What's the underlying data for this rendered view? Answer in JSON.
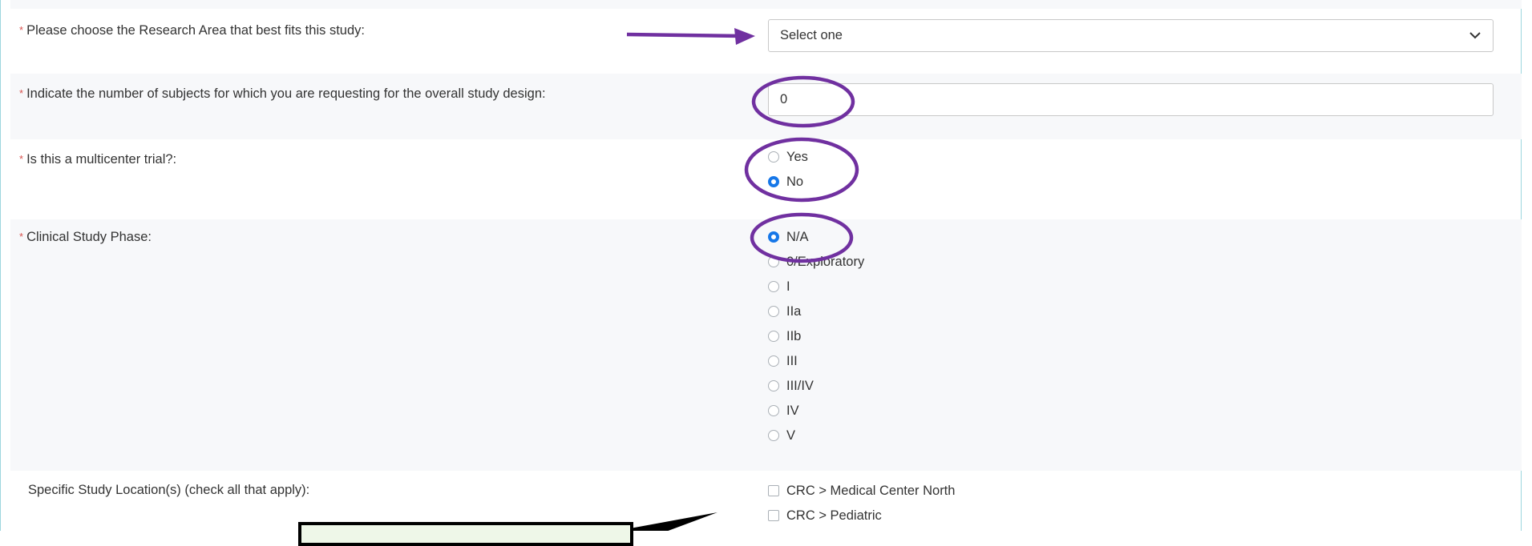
{
  "colors": {
    "annotation": "#7030a0",
    "radio_selected": "#1677e8",
    "required": "#d9534f",
    "frame": "#9cd6de"
  },
  "research_area": {
    "label": "Please choose the Research Area that best fits this study:",
    "selected": "Select one",
    "icon": "chevron-down-icon"
  },
  "subjects": {
    "label": "Indicate the number of subjects for which you are requesting for the overall study design:",
    "value": "0"
  },
  "multicenter": {
    "label": "Is this a multicenter trial?:",
    "options": [
      "Yes",
      "No"
    ],
    "selected": "No"
  },
  "phase": {
    "label": "Clinical Study Phase:",
    "options": [
      "N/A",
      "0/Exploratory",
      "I",
      "IIa",
      "IIb",
      "III",
      "III/IV",
      "IV",
      "V"
    ],
    "selected": "N/A"
  },
  "location": {
    "label": "Specific Study Location(s) (check all that apply):",
    "options": [
      "CRC > Medical Center North",
      "CRC > Pediatric"
    ]
  },
  "required_marker": "*"
}
